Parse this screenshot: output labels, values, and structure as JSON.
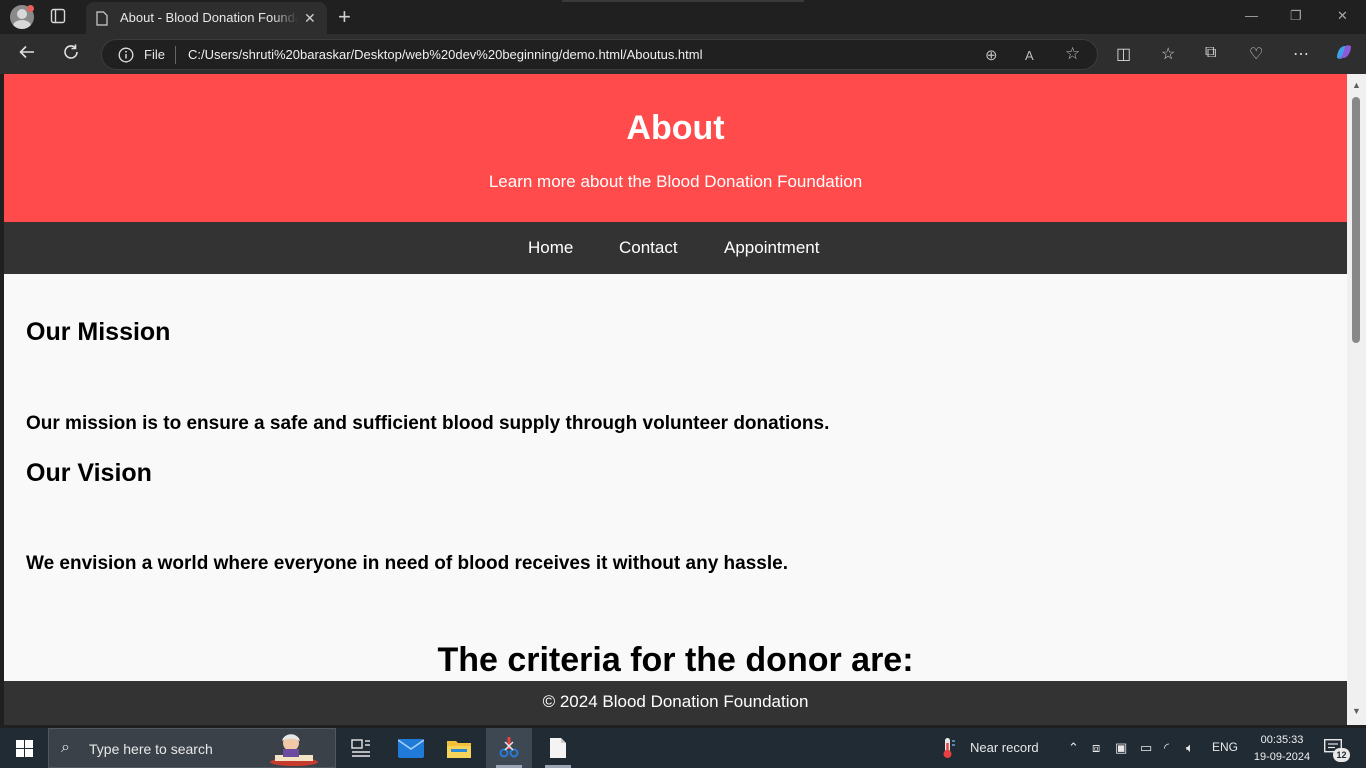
{
  "browser": {
    "tab_title": "About - Blood Donation Foundation",
    "new_tab_symbol": "+",
    "omnibox_scheme": "File",
    "url": "C:/Users/shruti%20baraskar/Desktop/web%20dev%20beginning/demo.html/Aboutus.html",
    "icons": [
      "profile-avatar-icon",
      "tab-actions-icon",
      "page-icon",
      "close-icon",
      "back-icon",
      "refresh-icon",
      "info-icon",
      "zoom-icon",
      "read-aloud-icon",
      "favorite-star-icon",
      "split-screen-icon",
      "favorites-icon",
      "collections-icon",
      "performance-icon",
      "more-icon",
      "copilot-icon"
    ]
  },
  "page": {
    "hero": {
      "title": "About",
      "subtitle": "Learn more about the Blood Donation Foundation"
    },
    "nav": [
      {
        "label": "Home"
      },
      {
        "label": "Contact"
      },
      {
        "label": "Appointment"
      }
    ],
    "mission": {
      "heading": "Our Mission",
      "text": "Our mission is to ensure a safe and sufficient blood supply through volunteer donations."
    },
    "vision": {
      "heading": "Our Vision",
      "text": "We envision a world where everyone in need of blood receives it without any hassle."
    },
    "criteria_heading": "The criteria for the donor are:",
    "footer": "© 2024 Blood Donation Foundation"
  },
  "taskbar": {
    "search_placeholder": "Type here to search",
    "weather_text": "Near record",
    "language": "ENG",
    "time": "00:35:33",
    "date": "19-09-2024",
    "notification_count": "12"
  },
  "colors": {
    "hero_bg": "#ff4b4b",
    "nav_bg": "#333333",
    "page_bg": "#f9f9f9",
    "taskbar_bg": "#202b34"
  }
}
